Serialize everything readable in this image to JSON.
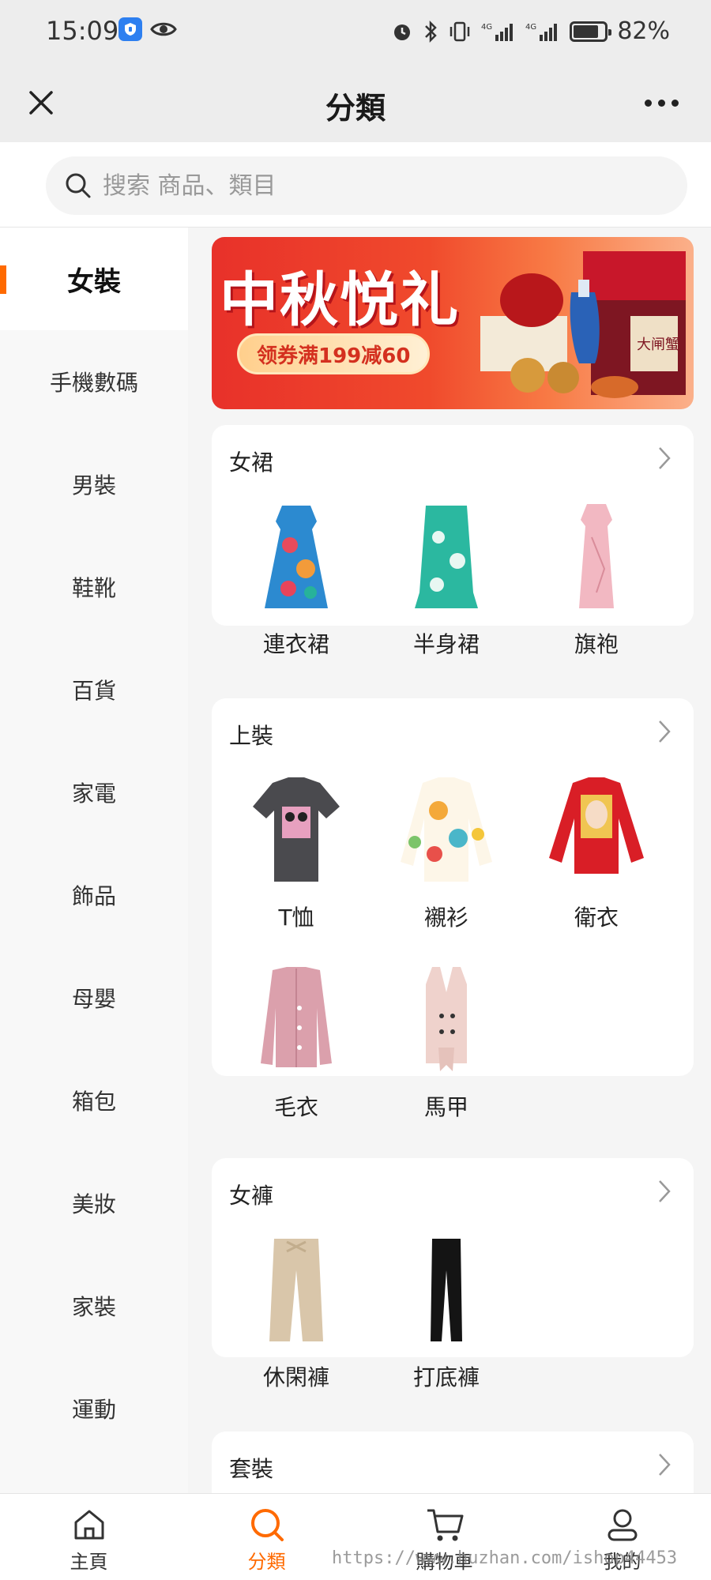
{
  "status_bar": {
    "time": "15:09",
    "battery_text": "82%",
    "battery_level": 0.82,
    "network_1": "4G",
    "network_2": "4G"
  },
  "header": {
    "title": "分類"
  },
  "search": {
    "placeholder": "搜索 商品、類目"
  },
  "sidebar": {
    "items": [
      {
        "label": "女裝",
        "active": true
      },
      {
        "label": "手機數碼"
      },
      {
        "label": "男裝"
      },
      {
        "label": "鞋靴"
      },
      {
        "label": "百貨"
      },
      {
        "label": "家電"
      },
      {
        "label": "飾品"
      },
      {
        "label": "母嬰"
      },
      {
        "label": "箱包"
      },
      {
        "label": "美妝"
      },
      {
        "label": "家裝"
      },
      {
        "label": "運動"
      }
    ]
  },
  "banner": {
    "title": "中秋悦礼",
    "subtitle": "领券满199减60",
    "box_text": "大闸蟹"
  },
  "sections": [
    {
      "title": "女裙",
      "items": [
        {
          "label": "連衣裙"
        },
        {
          "label": "半身裙"
        },
        {
          "label": "旗袍"
        }
      ]
    },
    {
      "title": "上裝",
      "items": [
        {
          "label": "T恤"
        },
        {
          "label": "襯衫"
        },
        {
          "label": "衛衣"
        },
        {
          "label": "毛衣"
        },
        {
          "label": "馬甲"
        }
      ]
    },
    {
      "title": "女褲",
      "items": [
        {
          "label": "休閑褲"
        },
        {
          "label": "打底褲"
        }
      ]
    },
    {
      "title": "套裝",
      "items": []
    }
  ],
  "bottom_nav": [
    {
      "label": "主頁",
      "icon": "home-icon"
    },
    {
      "label": "分類",
      "icon": "search-icon",
      "active": true
    },
    {
      "label": "購物車",
      "icon": "cart-icon"
    },
    {
      "label": "我的",
      "icon": "user-icon"
    }
  ],
  "watermark": "https://www.huzhan.com/ishop44453",
  "colors": {
    "accent": "#ff6a00",
    "banner_red": "#e8312a"
  }
}
